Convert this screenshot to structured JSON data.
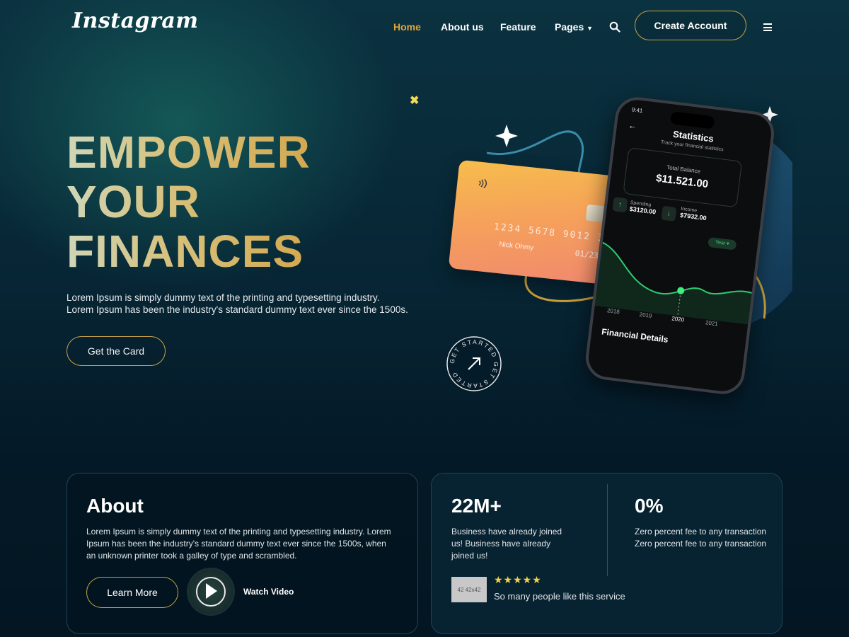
{
  "brand": {
    "logo_text": "Instagram"
  },
  "nav": {
    "items": [
      {
        "label": "Home",
        "active": true
      },
      {
        "label": "About us",
        "active": false
      },
      {
        "label": "Feature",
        "active": false
      },
      {
        "label": "Pages",
        "active": false
      }
    ],
    "search_icon": "search-icon",
    "create_account_label": "Create Account",
    "menu_icon": "hamburger-icon"
  },
  "hero": {
    "title_lines": [
      "EMPOWER",
      "YOUR",
      "FINANCES"
    ],
    "description_line1": "Lorem Ipsum is simply dummy text of the printing and typesetting industry.",
    "description_line2": "Lorem Ipsum has been the industry's standard dummy text ever since the 1500s.",
    "cta_label": "Get the Card"
  },
  "credit_card": {
    "number": "1234 5678 9012 3456",
    "holder": "Nick Ohmy",
    "expiry": "01/23"
  },
  "phone": {
    "time": "9:41",
    "screen_title": "Statistics",
    "screen_subtitle": "Track your financial statistics",
    "balance_label": "Total Balance",
    "balance_value": "$11.521.00",
    "spending_label": "Spending",
    "spending_value": "$3120.00",
    "income_label": "Income",
    "income_value": "$7932.00",
    "period_label": "Year",
    "years": [
      "2018",
      "2019",
      "2020",
      "2021"
    ],
    "section_title": "Financial Details"
  },
  "badge": {
    "circle_text": "GET STARTED GET STARTED"
  },
  "about": {
    "title": "About",
    "line1": "Lorem Ipsum is simply dummy text of the printing and typesetting industry. Lorem",
    "line2": "Ipsum has been the industry's standard dummy text ever since the 1500s, when",
    "line3": "an unknown printer took a galley of type and scrambled.",
    "learn_more_label": "Learn More",
    "watch_video_label": "Watch Video"
  },
  "stats": {
    "stat1_value": "22M+",
    "stat1_line1": "Business have already joined",
    "stat1_line2": "us! Business have already",
    "stat1_line3": "joined us!",
    "stat2_value": "0%",
    "stat2_line1": "Zero percent fee to any transaction",
    "stat2_line2": "Zero percent fee to any transaction",
    "thumb_text": "42  42x42",
    "rating_stars": 5,
    "stars_text": "★★★★★",
    "rating_text": "So many people like this service"
  },
  "colors": {
    "accent": "#e3a43a",
    "gold_border": "#c9a24a",
    "star": "#f2d347"
  }
}
